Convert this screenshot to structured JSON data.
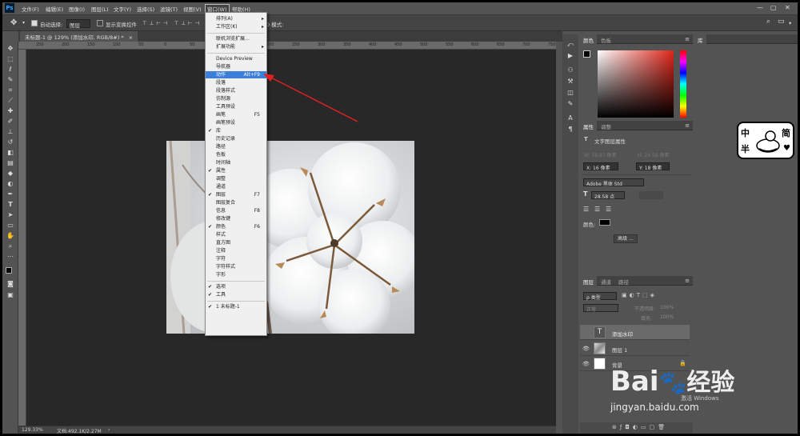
{
  "app": {
    "logo": "Ps"
  },
  "menubar": {
    "items": [
      "文件(F)",
      "编辑(E)",
      "图像(I)",
      "图层(L)",
      "文字(Y)",
      "选择(S)",
      "滤镜(T)",
      "视图(V)",
      "窗口(W)",
      "帮助(H)"
    ],
    "window_controls": {
      "min": "—",
      "max": "▢",
      "close": "✕"
    }
  },
  "options": {
    "auto_select_label": "自动选择:",
    "auto_select_value": "图层",
    "transform_label": "显示变换控件",
    "mode3d": "3D 模式:"
  },
  "document": {
    "tab_title": "未标题-1 @ 129% (添加水印, RGB/8#) *",
    "zoom": "129.33%",
    "doc_info": "文档:492.1K/2.27M"
  },
  "ruler": {
    "ticks": [
      "250",
      "200",
      "150",
      "100",
      "50",
      "0",
      "50",
      "100",
      "150",
      "200",
      "250",
      "300",
      "350",
      "400",
      "450",
      "500",
      "550",
      "600",
      "650",
      "700",
      "750"
    ]
  },
  "window_menu": [
    {
      "label": "排列(A)",
      "arrow": true
    },
    {
      "label": "工作区(K)",
      "arrow": true
    },
    {
      "sep": true
    },
    {
      "label": "联机浏览扩展..."
    },
    {
      "label": "扩展功能",
      "arrow": true
    },
    {
      "sep": true
    },
    {
      "label": "Device Preview"
    },
    {
      "label": "导航器"
    },
    {
      "label": "动作",
      "shortcut": "Alt+F9",
      "highlight": true
    },
    {
      "label": "段落"
    },
    {
      "label": "段落样式"
    },
    {
      "label": "仿制源"
    },
    {
      "label": "工具预设"
    },
    {
      "label": "画笔",
      "shortcut": "F5"
    },
    {
      "label": "画笔预设"
    },
    {
      "label": "库",
      "checked": true
    },
    {
      "label": "历史记录"
    },
    {
      "label": "路径"
    },
    {
      "label": "色板"
    },
    {
      "label": "时间轴"
    },
    {
      "label": "属性",
      "checked": true
    },
    {
      "label": "调整"
    },
    {
      "label": "通道"
    },
    {
      "label": "图层",
      "checked": true,
      "shortcut": "F7"
    },
    {
      "label": "图层复合"
    },
    {
      "label": "信息",
      "shortcut": "F8"
    },
    {
      "label": "修改键"
    },
    {
      "label": "颜色",
      "checked": true,
      "shortcut": "F6"
    },
    {
      "label": "样式"
    },
    {
      "label": "直方图"
    },
    {
      "label": "注释"
    },
    {
      "label": "字符"
    },
    {
      "label": "字符样式"
    },
    {
      "label": "字形"
    },
    {
      "sep": true
    },
    {
      "label": "选项",
      "checked": true
    },
    {
      "label": "工具",
      "checked": true
    },
    {
      "sep": true
    },
    {
      "label": "1 未标题-1",
      "checked": true
    }
  ],
  "color_panel": {
    "tabs": [
      "颜色",
      "色板"
    ]
  },
  "library_panel": {
    "tab": "库"
  },
  "properties_panel": {
    "tabs": [
      "属性",
      "调整"
    ],
    "header": "文字图层属性",
    "w": "W: 56.87 像素",
    "h": "H: 24.56 像素",
    "x": "X: 16 像素",
    "y": "Y: 18 像素",
    "font": "Adobe 黑体 Std",
    "size": "28.58 点",
    "color_label": "颜色:",
    "advanced": "高级 ..."
  },
  "layers_panel": {
    "tabs": [
      "图层",
      "通道",
      "路径"
    ],
    "filter": "ρ 类型",
    "blend": "正常",
    "opacity_label": "不透明度:",
    "opacity": "100%",
    "fill_label": "填充:",
    "fill": "100%",
    "layers": [
      {
        "name": "添加水印",
        "type": "text",
        "selected": true
      },
      {
        "name": "图层 1",
        "type": "image"
      },
      {
        "name": "背景",
        "type": "white"
      }
    ]
  },
  "watermark": {
    "logo": "Bai",
    "logo2": "经验",
    "sub": "jingyan.baidu.com",
    "win": "激活 Windows"
  },
  "sticker": {
    "l1": "中",
    "l2": "半",
    "r1": "简"
  },
  "colors": {
    "highlight": "#3c7fd9",
    "arrow": "#e02020",
    "canvas": "#282828"
  }
}
